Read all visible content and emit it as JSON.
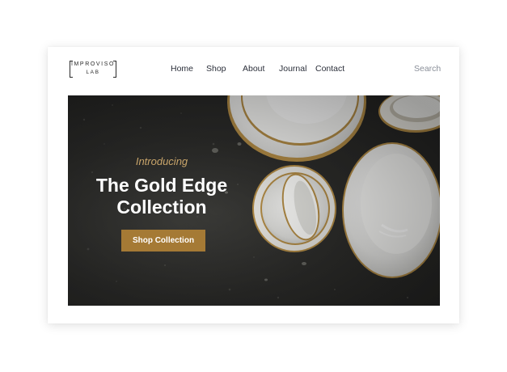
{
  "brand": {
    "line1": "IMPROVISO",
    "line2": "LAB"
  },
  "nav": {
    "home": "Home",
    "shop": "Shop",
    "about": "About",
    "journal": "Journal",
    "contact": "Contact"
  },
  "search": {
    "label": "Search"
  },
  "hero": {
    "intro": "Introducing",
    "title_line1": "The Gold Edge",
    "title_line2": "Collection",
    "cta": "Shop Collection"
  },
  "colors": {
    "accent": "#a57a35",
    "intro_text": "#c9a56a",
    "backdrop": "#2c2c2a",
    "gold_rim": "#b08a45"
  }
}
